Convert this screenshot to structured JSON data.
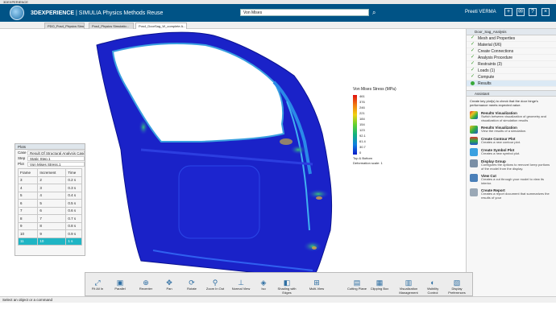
{
  "window": {
    "title": "3DEXPERIENCE"
  },
  "topbar": {
    "brand_bold": "3DEXPERIENCE",
    "brand_rest": " | SIMULIA Physics Methods Reuse",
    "search_value": "Von Mises",
    "username": "Preeti VERMA"
  },
  "tabs": [
    {
      "label": "PDO_Pos4_Physics Simulati..."
    },
    {
      "label": "Pos4_Physics Simulatio..."
    },
    {
      "label": "Pos4_DoorSag_W_complete A..."
    }
  ],
  "legend": {
    "title": "Von Mises Stress (MPa)",
    "values": [
      "461",
      "376",
      "246",
      "221",
      "184",
      "154",
      "123",
      "92.1",
      "61.4",
      "30.7",
      "0"
    ],
    "bottom_note": "Top & Bottom",
    "deformation": "Deformation scale: 1"
  },
  "plot_panel": {
    "title": "Plots",
    "case_label": "Case",
    "case_value": "Result Of Structural Analysis Case.1",
    "step_label": "Step",
    "step_value": "Static Step.1",
    "plot_label": "Plot",
    "plot_value": "Von Mises Stress.1",
    "columns": [
      "Frame",
      "Increment",
      "Time"
    ],
    "rows": [
      [
        "3",
        "2",
        "0.2 s"
      ],
      [
        "4",
        "3",
        "0.3 s"
      ],
      [
        "5",
        "4",
        "0.4 s"
      ],
      [
        "6",
        "5",
        "0.5 s"
      ],
      [
        "7",
        "6",
        "0.6 s"
      ],
      [
        "8",
        "7",
        "0.7 s"
      ],
      [
        "9",
        "8",
        "0.8 s"
      ],
      [
        "10",
        "9",
        "0.9 s"
      ],
      [
        "11",
        "10",
        "1 s"
      ]
    ]
  },
  "right_panel": {
    "header": "Door_Sag_Analysis",
    "steps": [
      "Mesh and Properties",
      "Material (6/6)",
      "Create Connections",
      "Analysis Procedure",
      "Restraints (3)",
      "Loads (1)",
      "Compute",
      "Results"
    ],
    "assistant_header": "Assistant",
    "assistant_text": "Create key plot(s) to check that the door hinge's performance meets expected value.",
    "items": [
      {
        "title": "Results Visualization",
        "desc": "Switch between visualization of geometry and visualization of simulation results"
      },
      {
        "title": "Results Visualization",
        "desc": "View the results of a simulation."
      },
      {
        "title": "Create Contour Plot",
        "desc": "Creates a new contour plot."
      },
      {
        "title": "Create Symbol Plot",
        "desc": "Creates a new symbol plot."
      },
      {
        "title": "Display Group",
        "desc": "Configures the options to remove/ keep portions of the model from the display."
      },
      {
        "title": "View Cut",
        "desc": "Creates a cut through your model to view its interior."
      },
      {
        "title": "Create Report",
        "desc": "Creates a report document that summarizes the results of your"
      }
    ]
  },
  "bottom_toolbar": {
    "tabs": [
      "View",
      "Tools",
      "Touch"
    ],
    "tools": [
      "Fit All In",
      "Parallel",
      "Recenter",
      "Pan",
      "Rotate",
      "Zoom In Out",
      "Normal View",
      "Iso",
      "Shading with Edges",
      "Multi-View",
      "Cutting Plane",
      "Clipping Box",
      "Visualization Management",
      "Visibility Control",
      "Display Preferences"
    ]
  },
  "status": {
    "prompt": "Select an object or a command"
  },
  "colors": {
    "topbar": "#005386",
    "accent": "#1fb5c4"
  }
}
